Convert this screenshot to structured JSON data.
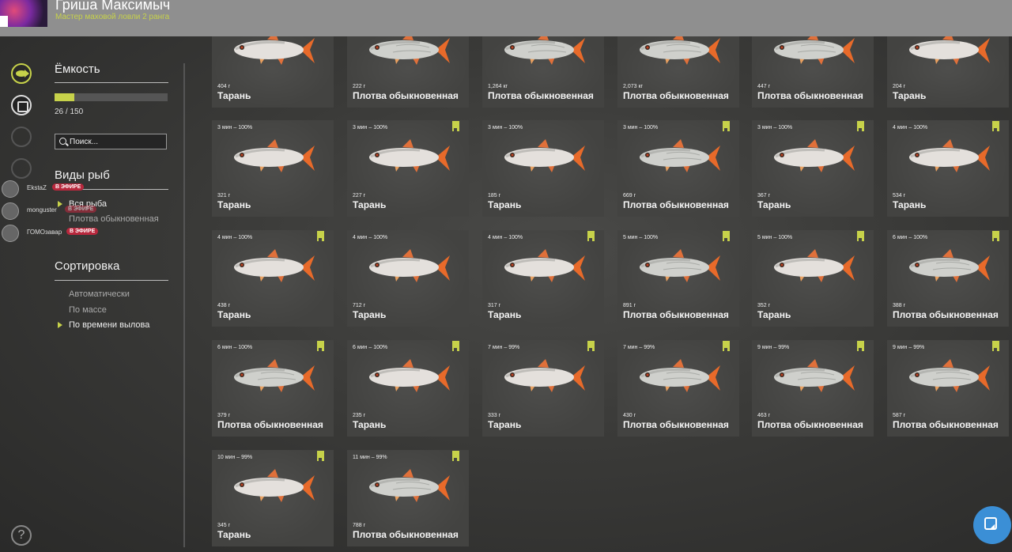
{
  "user": {
    "name": "Гриша Максимыч",
    "rank": "Мастер маховой ловли 2 ранга"
  },
  "sidebar": {
    "capacity_title": "Ёмкость",
    "capacity_text": "26 / 150",
    "capacity_fraction": 0.173,
    "search_placeholder": "Поиск...",
    "species_title": "Виды рыб",
    "species": [
      {
        "label": "Вся рыба",
        "active": true
      },
      {
        "label": "Плотва обыкновенная",
        "active": false
      }
    ],
    "sort_title": "Сортировка",
    "sort_options": [
      {
        "label": "Автоматически",
        "active": false
      },
      {
        "label": "По массе",
        "active": false
      },
      {
        "label": "По времени вылова",
        "active": true
      }
    ]
  },
  "streamers": [
    {
      "name": "EkstaZ",
      "badge": "В ЭФИРЕ"
    },
    {
      "name": "monguster",
      "badge": "В ЭФИРЕ"
    },
    {
      "name": "ГОМОзавар",
      "badge": "В ЭФИРЕ"
    }
  ],
  "colors": {
    "accent": "#c7d24a",
    "live_badge": "#b8283d",
    "card_bg": "#434341",
    "fab": "#3b8fd6"
  },
  "fish_cards": [
    {
      "time": "",
      "weight": "404 г",
      "name": "Тарань",
      "marked": false,
      "partial": true
    },
    {
      "time": "",
      "weight": "222 г",
      "name": "Плотва обыкновенная",
      "marked": false,
      "partial": true
    },
    {
      "time": "",
      "weight": "1,264 кг",
      "name": "Плотва обыкновенная",
      "marked": false,
      "partial": true
    },
    {
      "time": "",
      "weight": "2,073 кг",
      "name": "Плотва обыкновенная",
      "marked": false,
      "partial": true
    },
    {
      "time": "",
      "weight": "447 г",
      "name": "Плотва обыкновенная",
      "marked": false,
      "partial": true
    },
    {
      "time": "",
      "weight": "204 г",
      "name": "Тарань",
      "marked": false,
      "partial": true
    },
    {
      "time": "3 мин – 100%",
      "weight": "321 г",
      "name": "Тарань",
      "marked": false
    },
    {
      "time": "3 мин – 100%",
      "weight": "227 г",
      "name": "Тарань",
      "marked": true
    },
    {
      "time": "3 мин – 100%",
      "weight": "185 г",
      "name": "Тарань",
      "marked": false
    },
    {
      "time": "3 мин – 100%",
      "weight": "669 г",
      "name": "Плотва обыкновенная",
      "marked": true
    },
    {
      "time": "3 мин – 100%",
      "weight": "367 г",
      "name": "Тарань",
      "marked": true
    },
    {
      "time": "4 мин – 100%",
      "weight": "534 г",
      "name": "Тарань",
      "marked": true
    },
    {
      "time": "4 мин – 100%",
      "weight": "438 г",
      "name": "Тарань",
      "marked": true
    },
    {
      "time": "4 мин – 100%",
      "weight": "712 г",
      "name": "Тарань",
      "marked": false
    },
    {
      "time": "4 мин – 100%",
      "weight": "317 г",
      "name": "Тарань",
      "marked": true
    },
    {
      "time": "5 мин – 100%",
      "weight": "891 г",
      "name": "Плотва обыкновенная",
      "marked": true
    },
    {
      "time": "5 мин – 100%",
      "weight": "352 г",
      "name": "Тарань",
      "marked": true
    },
    {
      "time": "6 мин – 100%",
      "weight": "388 г",
      "name": "Плотва обыкновенная",
      "marked": true
    },
    {
      "time": "6 мин – 100%",
      "weight": "379 г",
      "name": "Плотва обыкновенная",
      "marked": true
    },
    {
      "time": "6 мин – 100%",
      "weight": "235 г",
      "name": "Тарань",
      "marked": true
    },
    {
      "time": "7 мин – 99%",
      "weight": "333 г",
      "name": "Тарань",
      "marked": true
    },
    {
      "time": "7 мин – 99%",
      "weight": "430 г",
      "name": "Плотва обыкновенная",
      "marked": true
    },
    {
      "time": "9 мин – 99%",
      "weight": "463 г",
      "name": "Плотва обыкновенная",
      "marked": true
    },
    {
      "time": "9 мин – 99%",
      "weight": "587 г",
      "name": "Плотва обыкновенная",
      "marked": true
    },
    {
      "time": "10 мин – 99%",
      "weight": "345 г",
      "name": "Тарань",
      "marked": true
    },
    {
      "time": "11 мин – 99%",
      "weight": "788 г",
      "name": "Плотва обыкновенная",
      "marked": true
    }
  ]
}
